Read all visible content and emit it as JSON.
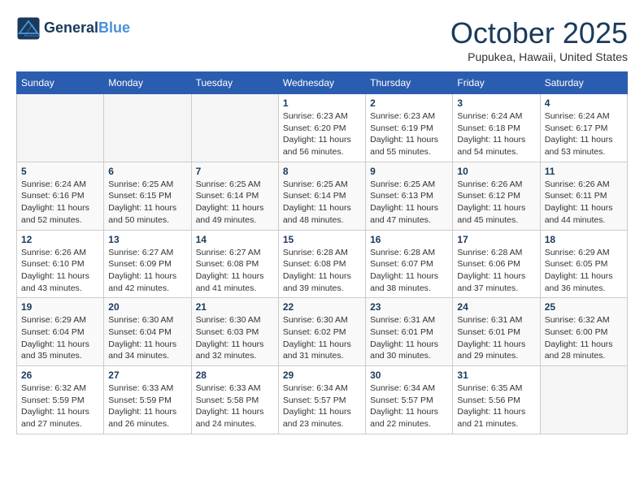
{
  "header": {
    "logo_line1": "General",
    "logo_line2": "Blue",
    "month": "October 2025",
    "location": "Pupukea, Hawaii, United States"
  },
  "weekdays": [
    "Sunday",
    "Monday",
    "Tuesday",
    "Wednesday",
    "Thursday",
    "Friday",
    "Saturday"
  ],
  "weeks": [
    [
      {
        "day": "",
        "info": ""
      },
      {
        "day": "",
        "info": ""
      },
      {
        "day": "",
        "info": ""
      },
      {
        "day": "1",
        "info": "Sunrise: 6:23 AM\nSunset: 6:20 PM\nDaylight: 11 hours and 56 minutes."
      },
      {
        "day": "2",
        "info": "Sunrise: 6:23 AM\nSunset: 6:19 PM\nDaylight: 11 hours and 55 minutes."
      },
      {
        "day": "3",
        "info": "Sunrise: 6:24 AM\nSunset: 6:18 PM\nDaylight: 11 hours and 54 minutes."
      },
      {
        "day": "4",
        "info": "Sunrise: 6:24 AM\nSunset: 6:17 PM\nDaylight: 11 hours and 53 minutes."
      }
    ],
    [
      {
        "day": "5",
        "info": "Sunrise: 6:24 AM\nSunset: 6:16 PM\nDaylight: 11 hours and 52 minutes."
      },
      {
        "day": "6",
        "info": "Sunrise: 6:25 AM\nSunset: 6:15 PM\nDaylight: 11 hours and 50 minutes."
      },
      {
        "day": "7",
        "info": "Sunrise: 6:25 AM\nSunset: 6:14 PM\nDaylight: 11 hours and 49 minutes."
      },
      {
        "day": "8",
        "info": "Sunrise: 6:25 AM\nSunset: 6:14 PM\nDaylight: 11 hours and 48 minutes."
      },
      {
        "day": "9",
        "info": "Sunrise: 6:25 AM\nSunset: 6:13 PM\nDaylight: 11 hours and 47 minutes."
      },
      {
        "day": "10",
        "info": "Sunrise: 6:26 AM\nSunset: 6:12 PM\nDaylight: 11 hours and 45 minutes."
      },
      {
        "day": "11",
        "info": "Sunrise: 6:26 AM\nSunset: 6:11 PM\nDaylight: 11 hours and 44 minutes."
      }
    ],
    [
      {
        "day": "12",
        "info": "Sunrise: 6:26 AM\nSunset: 6:10 PM\nDaylight: 11 hours and 43 minutes."
      },
      {
        "day": "13",
        "info": "Sunrise: 6:27 AM\nSunset: 6:09 PM\nDaylight: 11 hours and 42 minutes."
      },
      {
        "day": "14",
        "info": "Sunrise: 6:27 AM\nSunset: 6:08 PM\nDaylight: 11 hours and 41 minutes."
      },
      {
        "day": "15",
        "info": "Sunrise: 6:28 AM\nSunset: 6:08 PM\nDaylight: 11 hours and 39 minutes."
      },
      {
        "day": "16",
        "info": "Sunrise: 6:28 AM\nSunset: 6:07 PM\nDaylight: 11 hours and 38 minutes."
      },
      {
        "day": "17",
        "info": "Sunrise: 6:28 AM\nSunset: 6:06 PM\nDaylight: 11 hours and 37 minutes."
      },
      {
        "day": "18",
        "info": "Sunrise: 6:29 AM\nSunset: 6:05 PM\nDaylight: 11 hours and 36 minutes."
      }
    ],
    [
      {
        "day": "19",
        "info": "Sunrise: 6:29 AM\nSunset: 6:04 PM\nDaylight: 11 hours and 35 minutes."
      },
      {
        "day": "20",
        "info": "Sunrise: 6:30 AM\nSunset: 6:04 PM\nDaylight: 11 hours and 34 minutes."
      },
      {
        "day": "21",
        "info": "Sunrise: 6:30 AM\nSunset: 6:03 PM\nDaylight: 11 hours and 32 minutes."
      },
      {
        "day": "22",
        "info": "Sunrise: 6:30 AM\nSunset: 6:02 PM\nDaylight: 11 hours and 31 minutes."
      },
      {
        "day": "23",
        "info": "Sunrise: 6:31 AM\nSunset: 6:01 PM\nDaylight: 11 hours and 30 minutes."
      },
      {
        "day": "24",
        "info": "Sunrise: 6:31 AM\nSunset: 6:01 PM\nDaylight: 11 hours and 29 minutes."
      },
      {
        "day": "25",
        "info": "Sunrise: 6:32 AM\nSunset: 6:00 PM\nDaylight: 11 hours and 28 minutes."
      }
    ],
    [
      {
        "day": "26",
        "info": "Sunrise: 6:32 AM\nSunset: 5:59 PM\nDaylight: 11 hours and 27 minutes."
      },
      {
        "day": "27",
        "info": "Sunrise: 6:33 AM\nSunset: 5:59 PM\nDaylight: 11 hours and 26 minutes."
      },
      {
        "day": "28",
        "info": "Sunrise: 6:33 AM\nSunset: 5:58 PM\nDaylight: 11 hours and 24 minutes."
      },
      {
        "day": "29",
        "info": "Sunrise: 6:34 AM\nSunset: 5:57 PM\nDaylight: 11 hours and 23 minutes."
      },
      {
        "day": "30",
        "info": "Sunrise: 6:34 AM\nSunset: 5:57 PM\nDaylight: 11 hours and 22 minutes."
      },
      {
        "day": "31",
        "info": "Sunrise: 6:35 AM\nSunset: 5:56 PM\nDaylight: 11 hours and 21 minutes."
      },
      {
        "day": "",
        "info": ""
      }
    ]
  ]
}
